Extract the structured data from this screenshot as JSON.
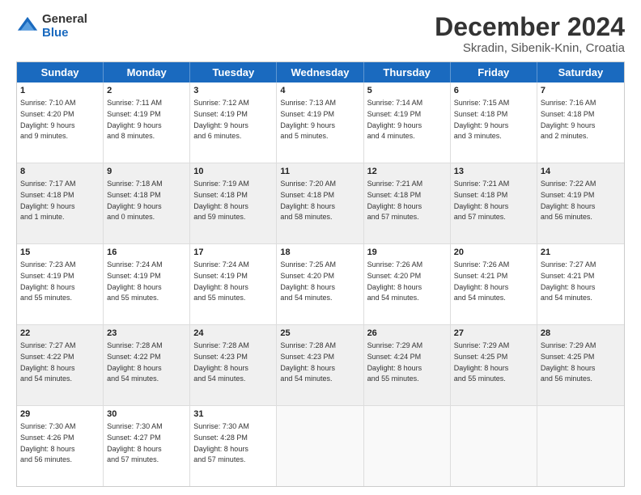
{
  "logo": {
    "general": "General",
    "blue": "Blue"
  },
  "title": "December 2024",
  "subtitle": "Skradin, Sibenik-Knin, Croatia",
  "days": [
    "Sunday",
    "Monday",
    "Tuesday",
    "Wednesday",
    "Thursday",
    "Friday",
    "Saturday"
  ],
  "rows": [
    [
      {
        "day": "1",
        "text": "Sunrise: 7:10 AM\nSunset: 4:20 PM\nDaylight: 9 hours\nand 9 minutes.",
        "shaded": false
      },
      {
        "day": "2",
        "text": "Sunrise: 7:11 AM\nSunset: 4:19 PM\nDaylight: 9 hours\nand 8 minutes.",
        "shaded": false
      },
      {
        "day": "3",
        "text": "Sunrise: 7:12 AM\nSunset: 4:19 PM\nDaylight: 9 hours\nand 6 minutes.",
        "shaded": false
      },
      {
        "day": "4",
        "text": "Sunrise: 7:13 AM\nSunset: 4:19 PM\nDaylight: 9 hours\nand 5 minutes.",
        "shaded": false
      },
      {
        "day": "5",
        "text": "Sunrise: 7:14 AM\nSunset: 4:19 PM\nDaylight: 9 hours\nand 4 minutes.",
        "shaded": false
      },
      {
        "day": "6",
        "text": "Sunrise: 7:15 AM\nSunset: 4:18 PM\nDaylight: 9 hours\nand 3 minutes.",
        "shaded": false
      },
      {
        "day": "7",
        "text": "Sunrise: 7:16 AM\nSunset: 4:18 PM\nDaylight: 9 hours\nand 2 minutes.",
        "shaded": false
      }
    ],
    [
      {
        "day": "8",
        "text": "Sunrise: 7:17 AM\nSunset: 4:18 PM\nDaylight: 9 hours\nand 1 minute.",
        "shaded": true
      },
      {
        "day": "9",
        "text": "Sunrise: 7:18 AM\nSunset: 4:18 PM\nDaylight: 9 hours\nand 0 minutes.",
        "shaded": true
      },
      {
        "day": "10",
        "text": "Sunrise: 7:19 AM\nSunset: 4:18 PM\nDaylight: 8 hours\nand 59 minutes.",
        "shaded": true
      },
      {
        "day": "11",
        "text": "Sunrise: 7:20 AM\nSunset: 4:18 PM\nDaylight: 8 hours\nand 58 minutes.",
        "shaded": true
      },
      {
        "day": "12",
        "text": "Sunrise: 7:21 AM\nSunset: 4:18 PM\nDaylight: 8 hours\nand 57 minutes.",
        "shaded": true
      },
      {
        "day": "13",
        "text": "Sunrise: 7:21 AM\nSunset: 4:18 PM\nDaylight: 8 hours\nand 57 minutes.",
        "shaded": true
      },
      {
        "day": "14",
        "text": "Sunrise: 7:22 AM\nSunset: 4:19 PM\nDaylight: 8 hours\nand 56 minutes.",
        "shaded": true
      }
    ],
    [
      {
        "day": "15",
        "text": "Sunrise: 7:23 AM\nSunset: 4:19 PM\nDaylight: 8 hours\nand 55 minutes.",
        "shaded": false
      },
      {
        "day": "16",
        "text": "Sunrise: 7:24 AM\nSunset: 4:19 PM\nDaylight: 8 hours\nand 55 minutes.",
        "shaded": false
      },
      {
        "day": "17",
        "text": "Sunrise: 7:24 AM\nSunset: 4:19 PM\nDaylight: 8 hours\nand 55 minutes.",
        "shaded": false
      },
      {
        "day": "18",
        "text": "Sunrise: 7:25 AM\nSunset: 4:20 PM\nDaylight: 8 hours\nand 54 minutes.",
        "shaded": false
      },
      {
        "day": "19",
        "text": "Sunrise: 7:26 AM\nSunset: 4:20 PM\nDaylight: 8 hours\nand 54 minutes.",
        "shaded": false
      },
      {
        "day": "20",
        "text": "Sunrise: 7:26 AM\nSunset: 4:21 PM\nDaylight: 8 hours\nand 54 minutes.",
        "shaded": false
      },
      {
        "day": "21",
        "text": "Sunrise: 7:27 AM\nSunset: 4:21 PM\nDaylight: 8 hours\nand 54 minutes.",
        "shaded": false
      }
    ],
    [
      {
        "day": "22",
        "text": "Sunrise: 7:27 AM\nSunset: 4:22 PM\nDaylight: 8 hours\nand 54 minutes.",
        "shaded": true
      },
      {
        "day": "23",
        "text": "Sunrise: 7:28 AM\nSunset: 4:22 PM\nDaylight: 8 hours\nand 54 minutes.",
        "shaded": true
      },
      {
        "day": "24",
        "text": "Sunrise: 7:28 AM\nSunset: 4:23 PM\nDaylight: 8 hours\nand 54 minutes.",
        "shaded": true
      },
      {
        "day": "25",
        "text": "Sunrise: 7:28 AM\nSunset: 4:23 PM\nDaylight: 8 hours\nand 54 minutes.",
        "shaded": true
      },
      {
        "day": "26",
        "text": "Sunrise: 7:29 AM\nSunset: 4:24 PM\nDaylight: 8 hours\nand 55 minutes.",
        "shaded": true
      },
      {
        "day": "27",
        "text": "Sunrise: 7:29 AM\nSunset: 4:25 PM\nDaylight: 8 hours\nand 55 minutes.",
        "shaded": true
      },
      {
        "day": "28",
        "text": "Sunrise: 7:29 AM\nSunset: 4:25 PM\nDaylight: 8 hours\nand 56 minutes.",
        "shaded": true
      }
    ],
    [
      {
        "day": "29",
        "text": "Sunrise: 7:30 AM\nSunset: 4:26 PM\nDaylight: 8 hours\nand 56 minutes.",
        "shaded": false
      },
      {
        "day": "30",
        "text": "Sunrise: 7:30 AM\nSunset: 4:27 PM\nDaylight: 8 hours\nand 57 minutes.",
        "shaded": false
      },
      {
        "day": "31",
        "text": "Sunrise: 7:30 AM\nSunset: 4:28 PM\nDaylight: 8 hours\nand 57 minutes.",
        "shaded": false
      },
      {
        "day": "",
        "text": "",
        "shaded": false,
        "empty": true
      },
      {
        "day": "",
        "text": "",
        "shaded": false,
        "empty": true
      },
      {
        "day": "",
        "text": "",
        "shaded": false,
        "empty": true
      },
      {
        "day": "",
        "text": "",
        "shaded": false,
        "empty": true
      }
    ]
  ]
}
